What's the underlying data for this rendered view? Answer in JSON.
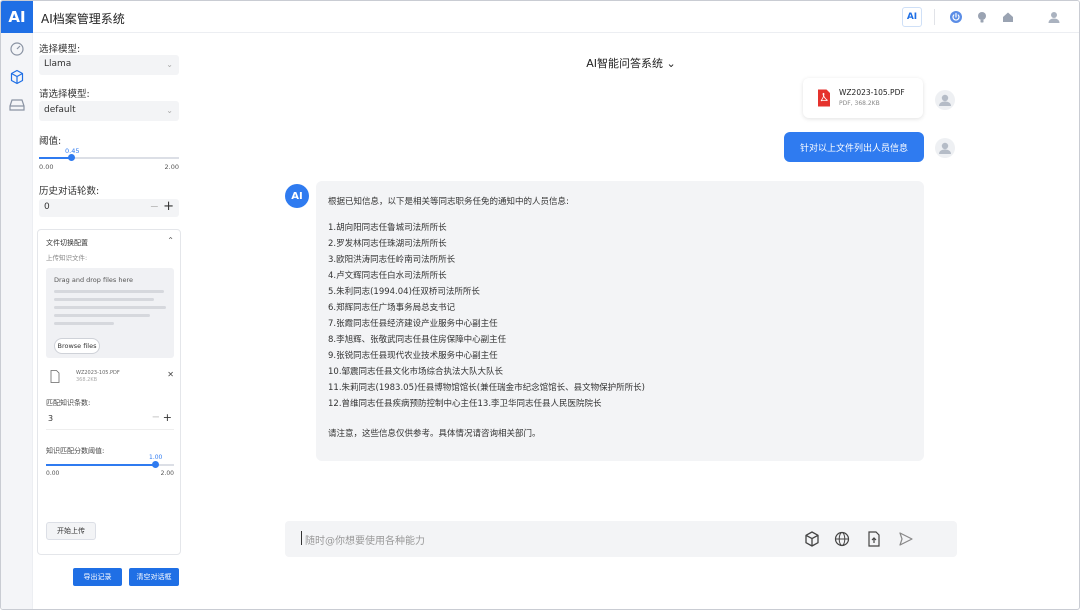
{
  "app": {
    "logo": "AI",
    "title": "AI档案管理系统"
  },
  "topbar": {
    "ai_badge": "AI",
    "icons": [
      "power-icon",
      "lightbulb-icon",
      "home-icon",
      "user-icon"
    ]
  },
  "rail": {
    "icons": [
      "dashboard-icon",
      "cube-icon",
      "drive-icon"
    ]
  },
  "settings": {
    "model_label": "选择模型:",
    "model_value": "Llama",
    "submodel_label": "请选择模型:",
    "submodel_value": "default",
    "threshold_label": "阈值:",
    "threshold": {
      "value": "0.45",
      "min": "0.00",
      "max": "2.00",
      "fraction": 0.225
    },
    "history_label": "历史对话轮数:",
    "history_value": "0"
  },
  "upload": {
    "header": "文件切换配置",
    "subheader": "上传知识文件:",
    "drop_title": "Drag and drop files here",
    "browse_label": "Browse files",
    "file_name": "WZ2023-105.PDF",
    "file_size": "368.2KB",
    "match_label": "匹配知识条数:",
    "match_value": "3",
    "sim_label": "知识匹配分数阈值:",
    "sim": {
      "value": "1.00",
      "min": "0.00",
      "max": "2.00",
      "fraction": 0.85
    },
    "start_label": "开始上传"
  },
  "buttons": {
    "export": "导出记录",
    "clear": "清空对话框"
  },
  "chat": {
    "title": "AI智能问答系统",
    "file_message": {
      "name": "WZ2023-105.PDF",
      "size": "PDF, 368.2KB"
    },
    "user_message": "针对以上文件列出人员信息",
    "ai_label": "AI",
    "ai_lines": [
      "根据已知信息，以下是相关等同志职务任免的通知中的人员信息:",
      "1.胡向阳同志任鲁城司法所所长",
      "2.罗发林同志任珠湖司法所所长",
      "3.欧阳洪涛同志任岭南司法所所长",
      "4.卢文辉同志任白水司法所所长",
      "5.朱利同志(1994.04)任双桥司法所所长",
      "6.郑辉同志任广场事务局总支书记",
      "7.张霞同志任县经济建设产业服务中心副主任",
      "8.李旭辉、张敬武同志任县住房保障中心副主任",
      "9.张锐同志任县现代农业技术服务中心副主任",
      "10.邹震同志任县文化市场综合执法大队大队长",
      "11.朱莉同志(1983.05)任县博物馆馆长(兼任瑞金市纪念馆馆长、县文物保护所所长)",
      "12.曾维同志任县疾病预防控制中心主任13.李卫华同志任县人民医院院长",
      "请注意，这些信息仅供参考。具体情况请咨询相关部门。"
    ]
  },
  "composer": {
    "placeholder": "随时@你想要使用各种能力",
    "icons": [
      "cube-icon",
      "globe-icon",
      "upload-file-icon",
      "send-icon"
    ]
  },
  "colors": {
    "accent": "#1f6fe5",
    "bubble": "#2f7bf0",
    "panel_bg": "#f3f4f6"
  }
}
